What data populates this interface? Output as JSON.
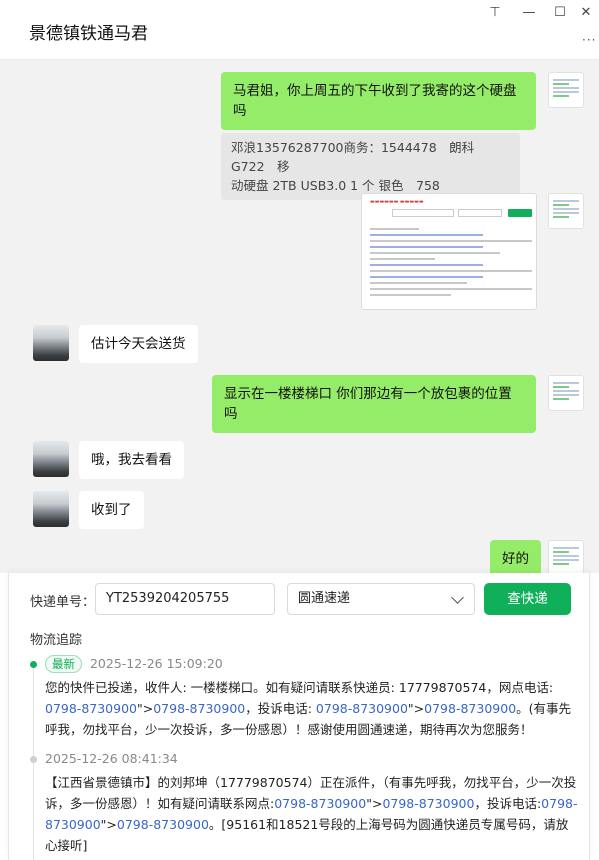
{
  "window": {
    "title": "景德镇铁通马君",
    "controls": {
      "pin": "⊤",
      "minimize": "—",
      "maximize": "☐",
      "close": "✕",
      "more": "···"
    }
  },
  "chat": {
    "messages": [
      {
        "from": "me",
        "lines": [
          "马君姐，你上周五的下午收到了我寄的这个硬盘",
          "吗"
        ]
      },
      {
        "from": "quote",
        "lines": [
          "邓浪13576287700商务：1544478　朗科　G722　移",
          "动硬盘 2TB USB3.0  1  个  银色　758"
        ]
      },
      {
        "from": "me",
        "type": "screenshot"
      },
      {
        "from": "other",
        "text": "估计今天会送货"
      },
      {
        "from": "me",
        "lines": [
          "显示在一楼楼梯口  你们那边有一个放包裹的位置",
          "吗"
        ]
      },
      {
        "from": "other",
        "text": "哦，我去看看"
      },
      {
        "from": "other",
        "text": "收到了"
      },
      {
        "from": "me",
        "text": "好的"
      }
    ]
  },
  "tracking": {
    "number_label": "快递单号：",
    "number_value": "YT2539204205755",
    "carrier": "圆通速递",
    "query_button": "查快递",
    "section_title": "物流追踪",
    "events": [
      {
        "badge": "最新",
        "time": "2025-12-26 15:09:20",
        "parts": [
          {
            "t": "您的快件已投递，收件人: 一楼楼梯口。如有疑问请联系快递员: 17779870574，网点电话: ",
            "link": false
          },
          {
            "t": "0798-8730900",
            "link": true
          },
          {
            "t": "\">",
            "link": false
          },
          {
            "t": "0798-8730900",
            "link": true
          },
          {
            "t": "，投诉电话: ",
            "link": false
          },
          {
            "t": "0798-8730900",
            "link": true
          },
          {
            "t": "\">",
            "link": false
          },
          {
            "t": "0798-8730900",
            "link": true
          },
          {
            "t": "。(有事先呼我，勿找平台，少一次投诉，多一份感恩）！感谢使用圆通速递，期待再次为您服务！",
            "link": false
          }
        ]
      },
      {
        "badge": "",
        "time": "2025-12-26 08:41:34",
        "parts": [
          {
            "t": "【江西省景德镇市】的刘邦坤（17779870574）正在派件，（有事先呼我，勿找平台，少一次投诉，多一份感恩）！如有疑问请联系网点:",
            "link": false
          },
          {
            "t": "0798-8730900",
            "link": true
          },
          {
            "t": "\">",
            "link": false
          },
          {
            "t": "0798-8730900",
            "link": true
          },
          {
            "t": "，投诉电话:",
            "link": false
          },
          {
            "t": "0798-8730900",
            "link": true
          },
          {
            "t": "\">",
            "link": false
          },
          {
            "t": "0798-8730900",
            "link": true
          },
          {
            "t": "。[95161和18521号段的上海号码为圆通快递员专属号码，请放心接听]",
            "link": false
          }
        ]
      }
    ]
  },
  "colors": {
    "accent": "#10b05a",
    "bubble_me": "#95ec69",
    "link": "#3a66c8",
    "chat_bg": "#f2f2f2"
  }
}
